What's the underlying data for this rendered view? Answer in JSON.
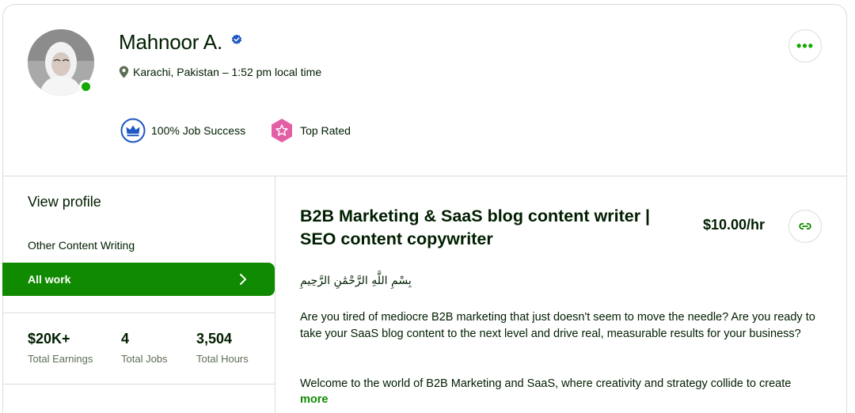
{
  "profile": {
    "name": "Mahnoor A.",
    "location": "Karachi, Pakistan – 1:52 pm local time",
    "online": true
  },
  "badges": [
    {
      "label": "100% Job Success",
      "icon": "crown-icon",
      "color": "#1f57c3"
    },
    {
      "label": "Top Rated",
      "icon": "star-badge-icon",
      "color": "#e35fa5"
    }
  ],
  "actions": {
    "more_label": "•••"
  },
  "sidebar": {
    "view_profile": "View profile",
    "category": "Other Content Writing",
    "all_work": "All work",
    "stats": [
      {
        "value": "$20K+",
        "caption": "Total Earnings"
      },
      {
        "value": "4",
        "caption": "Total Jobs"
      },
      {
        "value": "3,504",
        "caption": "Total Hours"
      }
    ]
  },
  "main": {
    "title": "B2B Marketing & SaaS blog content writer | SEO content copywriter",
    "rate": "$10.00/hr",
    "basmala": "بِسْمِ اللَّهِ الرَّحْمَٰنِ الرَّحِيمِ",
    "paragraph1": "Are you tired of mediocre B2B marketing that just doesn't seem to move the needle? Are you ready to take your SaaS blog content to the next level and drive real, measurable results for your business?",
    "paragraph2": "Welcome to the world of B2B Marketing and SaaS, where creativity and strategy collide to create",
    "more_label": "more"
  },
  "colors": {
    "accent": "#108a00",
    "online": "#14a800",
    "divider": "#d5e0d5"
  }
}
